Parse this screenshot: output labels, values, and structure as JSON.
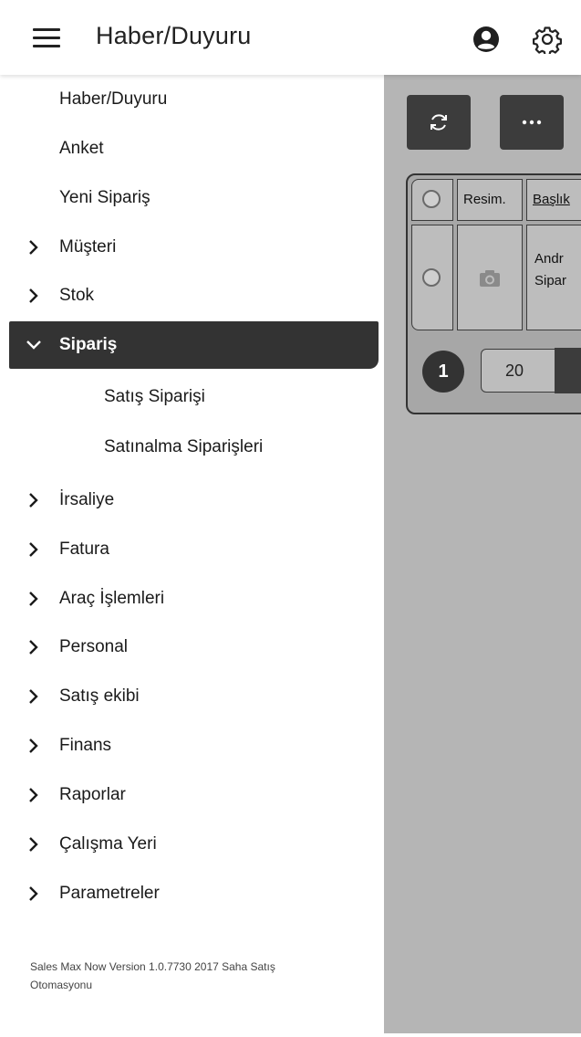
{
  "header": {
    "title": "Haber/Duyuru",
    "menu_icon": "hamburger-menu-icon",
    "user_icon": "user-circle-icon",
    "settings_icon": "gear-icon"
  },
  "sidebar": {
    "items": [
      {
        "label": "Haber/Duyuru"
      },
      {
        "label": "Anket"
      },
      {
        "label": "Yeni Sipariş"
      },
      {
        "label": "Müşteri"
      },
      {
        "label": "Stok"
      },
      {
        "label": "Sipariş"
      },
      {
        "label": "Satış Siparişi"
      },
      {
        "label": "Satınalma Siparişleri"
      },
      {
        "label": "İrsaliye"
      },
      {
        "label": "Fatura"
      },
      {
        "label": "Araç İşlemleri"
      },
      {
        "label": "Personal"
      },
      {
        "label": "Satış ekibi"
      },
      {
        "label": "Finans"
      },
      {
        "label": "Raporlar"
      },
      {
        "label": "Çalışma Yeri"
      },
      {
        "label": "Parametreler"
      }
    ],
    "footer_line1": "Sales Max Now Version 1.0.7730 2017 Saha Satış",
    "footer_line2": "Otomasyonu"
  },
  "content": {
    "toolbar": {
      "refresh_icon": "refresh-icon",
      "more_icon": "more-horizontal-icon"
    },
    "table": {
      "headers": [
        "Resim.",
        "Başlık"
      ],
      "row1_title_line1": "Andr",
      "row1_title_line2": "Sipar",
      "row1_image_icon": "camera-icon"
    },
    "pager": {
      "current_page": "1",
      "page_size": "20"
    }
  },
  "colors": {
    "active_nav_bg": "#333333",
    "overlay_bg": "#b5b5b5",
    "dark_button": "#3c3c3c"
  }
}
